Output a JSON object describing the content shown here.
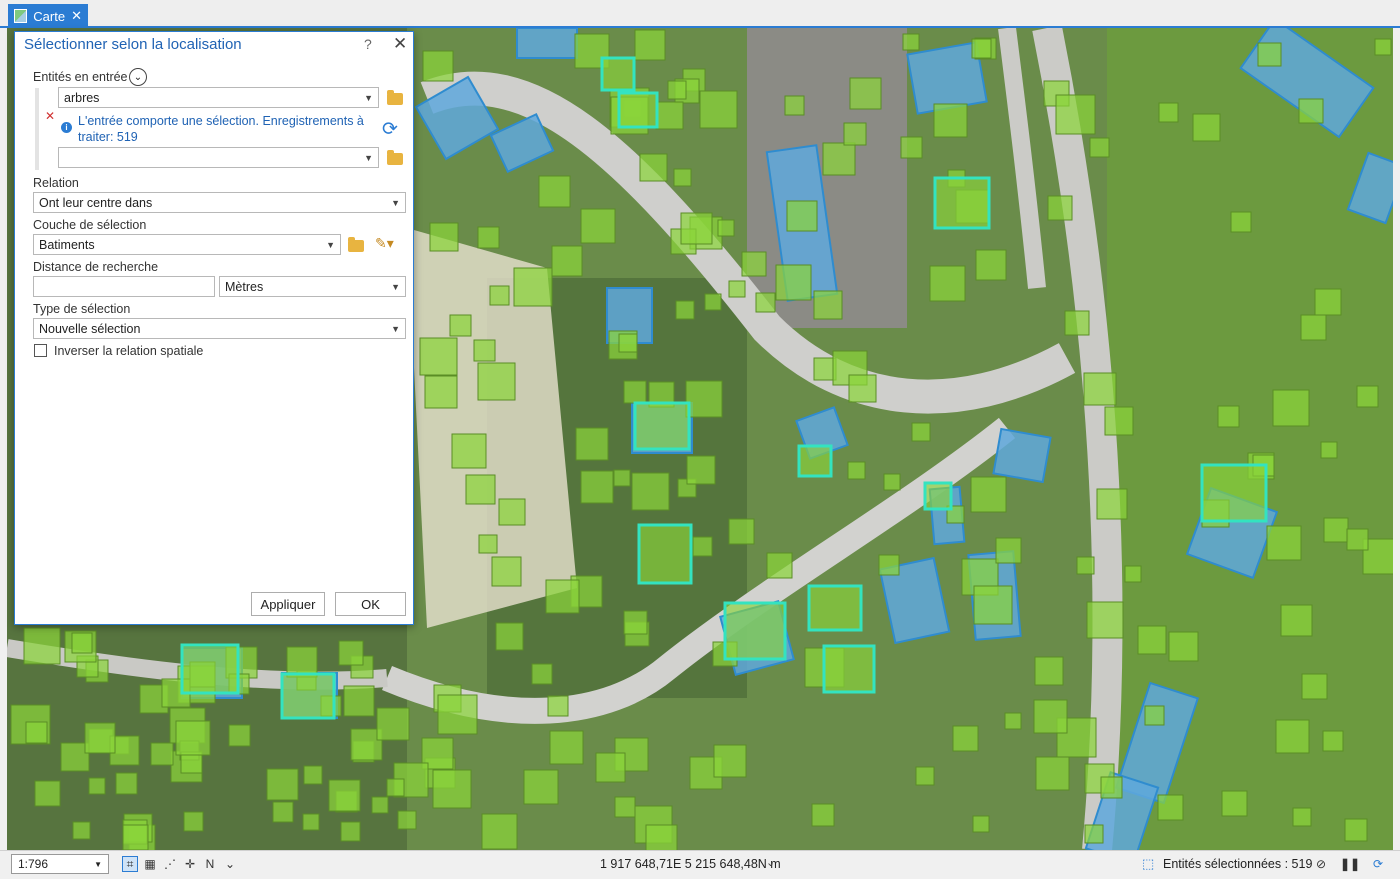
{
  "tab": {
    "title": "Carte",
    "icon": "map-icon",
    "close_icon": "close-icon"
  },
  "dialog": {
    "title": "Sélectionner selon la localisation",
    "help": "?",
    "close": "✕",
    "input_features": {
      "label": "Entités en entrée",
      "value1": "arbres",
      "value2": "",
      "message": "L'entrée comporte une sélection. Enregistrements à traiter: 519"
    },
    "relation": {
      "label": "Relation",
      "value": "Ont leur centre dans"
    },
    "selecting_layer": {
      "label": "Couche de sélection",
      "value": "Batiments"
    },
    "search_distance": {
      "label": "Distance de recherche",
      "value": "",
      "unit": "Mètres"
    },
    "selection_type": {
      "label": "Type de sélection",
      "value": "Nouvelle sélection"
    },
    "invert": {
      "label": "Inverser la relation spatiale",
      "checked": false
    },
    "apply_label": "Appliquer",
    "ok_label": "OK"
  },
  "statusbar": {
    "scale": "1:796",
    "coordinates": "1 917 648,71E 5 215 648,48N m",
    "selected": "Entités sélectionnées : 519"
  },
  "colors": {
    "accent": "#2b7cd3",
    "tree_fill": "#8bd43a",
    "building_fill": "#5fa8dc",
    "selected_outline": "#33e3c0"
  }
}
